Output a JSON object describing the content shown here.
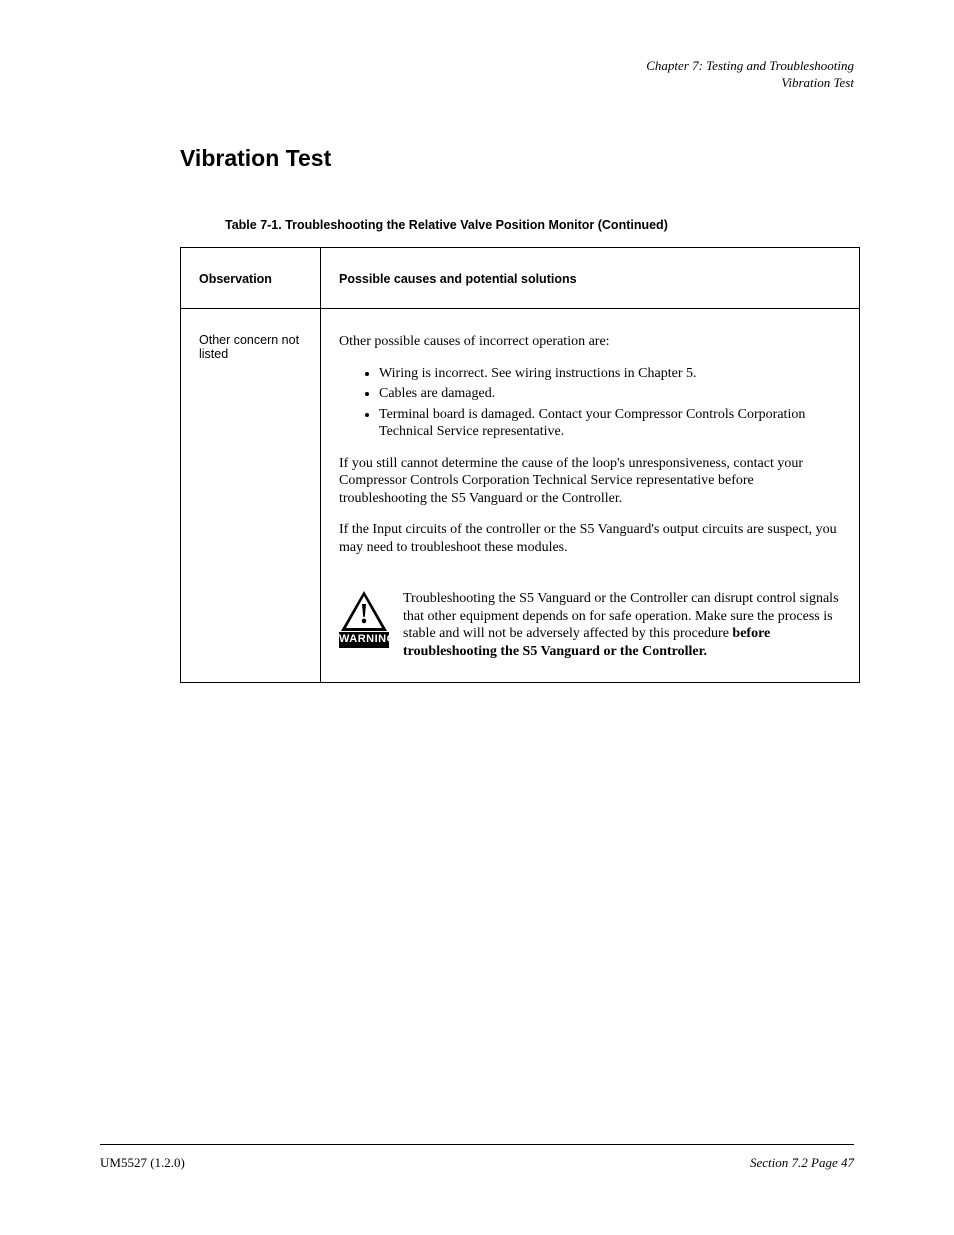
{
  "header": {
    "chapter": "Chapter 7:  Testing and Troubleshooting",
    "section": "Vibration Test"
  },
  "title": "Vibration Test",
  "table_caption": "Table 7-1. Troubleshooting the Relative Valve Position Monitor  (Continued)",
  "columns": {
    "left": "Observation",
    "right": "Possible causes and potential solutions"
  },
  "row": {
    "label": "Other concern not listed",
    "intro": "Other possible causes of incorrect operation are:",
    "bullets": [
      "Wiring is incorrect. See wiring instructions in Chapter 5.",
      "Cables are damaged.",
      "Terminal board is damaged. Contact your Compressor Controls Corporation Technical Service representative."
    ],
    "paras": [
      "If you still cannot determine the cause of the loop's unresponsiveness, contact your Compressor Controls Corporation Technical Service representative before troubleshooting the S5 Vanguard or the Controller.",
      "If the Input circuits of the controller or the S5 Vanguard's output circuits are suspect, you may need to troubleshoot these modules."
    ],
    "alert_label": "WARNING",
    "alert_text_pre": "Troubleshooting the S5 Vanguard or the Controller can disrupt control signals that other equipment depends on for safe operation. Make sure the process is stable and will not be adversely affected by this procedure",
    "alert_text_bold": " before troubleshooting the S5 Vanguard or the Controller."
  },
  "footer": {
    "left": "UM5527 (1.2.0)",
    "right": "Section 7.2  Page 47"
  }
}
